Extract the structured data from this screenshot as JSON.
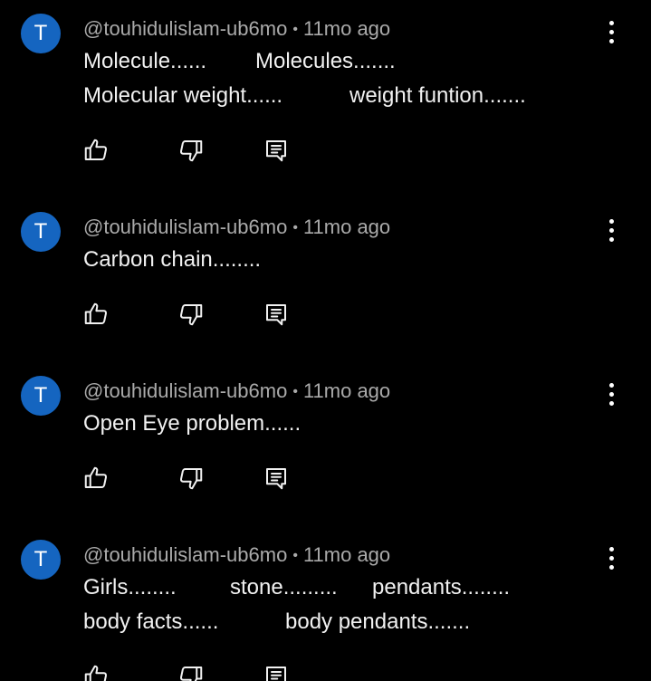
{
  "comments": [
    {
      "avatar_letter": "T",
      "author": "@touhidulislam-ub6mo",
      "separator": "•",
      "time": "11mo ago",
      "lines": [
        [
          "Molecule......",
          "Molecules......."
        ],
        [
          "Molecular weight......",
          "weight funtion......."
        ]
      ]
    },
    {
      "avatar_letter": "T",
      "author": "@touhidulislam-ub6mo",
      "separator": "•",
      "time": "11mo ago",
      "lines": [
        [
          "Carbon chain........"
        ]
      ]
    },
    {
      "avatar_letter": "T",
      "author": "@touhidulislam-ub6mo",
      "separator": "•",
      "time": "11mo ago",
      "lines": [
        [
          "Open Eye problem......"
        ]
      ]
    },
    {
      "avatar_letter": "T",
      "author": "@touhidulislam-ub6mo",
      "separator": "•",
      "time": "11mo ago",
      "lines": [
        [
          "Girls........",
          "stone.........",
          "pendants........"
        ],
        [
          "body facts......",
          "body pendants......."
        ]
      ]
    }
  ],
  "icons": {
    "like": "thumbs-up-icon",
    "dislike": "thumbs-down-icon",
    "reply": "reply-icon",
    "more": "more-vertical-icon"
  },
  "colors": {
    "background": "#000000",
    "avatar": "#1565c0",
    "meta_text": "#aaaaaa",
    "body_text": "#f1f1f1"
  }
}
